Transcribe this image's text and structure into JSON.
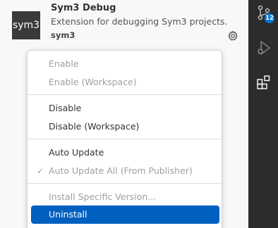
{
  "extension": {
    "icon_text": "sym3",
    "name": "Sym3 Debug",
    "description": "Extension for debugging Sym3 projects.",
    "publisher": "sym3"
  },
  "activity_bar": {
    "icons": [
      "source-control-icon",
      "run-debug-icon",
      "extensions-icon"
    ],
    "badge": "12",
    "colors": {
      "background": "#2c2c2c",
      "badge": "#0078d4"
    }
  },
  "menu": {
    "items": [
      {
        "label": "Enable",
        "state": "disabled"
      },
      {
        "label": "Enable (Workspace)",
        "state": "disabled"
      },
      {
        "label": "Disable",
        "state": "enabled"
      },
      {
        "label": "Disable (Workspace)",
        "state": "enabled"
      },
      {
        "label": "Auto Update",
        "state": "enabled"
      },
      {
        "label": "Auto Update All (From Publisher)",
        "state": "disabled",
        "checked": true
      },
      {
        "label": "Install Specific Version...",
        "state": "disabled"
      },
      {
        "label": "Uninstall",
        "state": "selected"
      }
    ],
    "colors": {
      "selected": "#0060c0",
      "disabled_text": "#a0a0a0"
    }
  }
}
